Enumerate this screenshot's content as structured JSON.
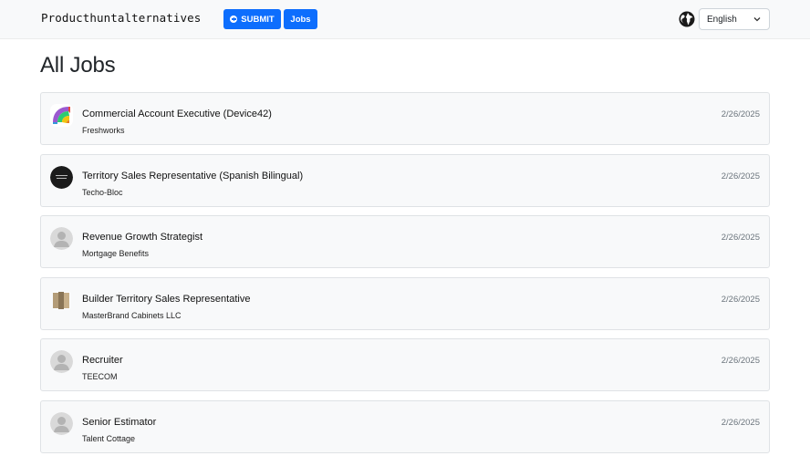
{
  "brand": "Producthuntalternatives",
  "nav": {
    "submit_label": "SUBMIT",
    "jobs_label": "Jobs",
    "language": "English"
  },
  "page_title": "All Jobs",
  "jobs": [
    {
      "title": "Commercial Account Executive (Device42)",
      "company": "Freshworks",
      "date": "2/26/2025",
      "logo": "freshworks-logo"
    },
    {
      "title": "Territory Sales Representative (Spanish Bilingual)",
      "company": "Techo-Bloc",
      "date": "2/26/2025",
      "logo": "techo-bloc-logo"
    },
    {
      "title": "Revenue Growth Strategist",
      "company": "Mortgage Benefits",
      "date": "2/26/2025",
      "logo": "default-avatar"
    },
    {
      "title": "Builder Territory Sales Representative",
      "company": "MasterBrand Cabinets LLC",
      "date": "2/26/2025",
      "logo": "masterbrand-logo"
    },
    {
      "title": "Recruiter",
      "company": "TEECOM",
      "date": "2/26/2025",
      "logo": "default-avatar"
    },
    {
      "title": "Senior Estimator",
      "company": "Talent Cottage",
      "date": "2/26/2025",
      "logo": "default-avatar"
    }
  ],
  "colors": {
    "accent": "#0d6efd",
    "card_bg": "#f8f9fa",
    "card_border": "#dfe2e5",
    "navbar_bg": "#f8f9fa"
  }
}
